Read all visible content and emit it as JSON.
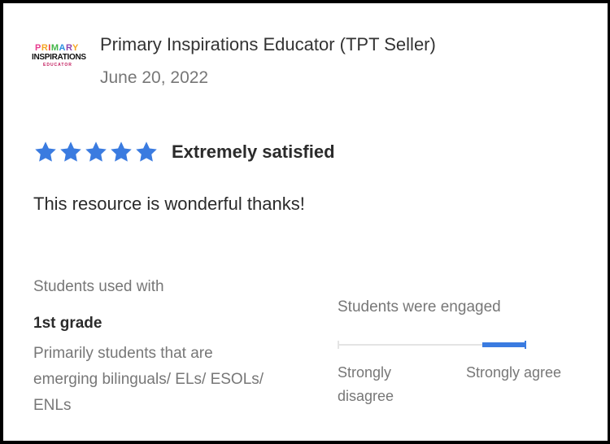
{
  "review": {
    "logo": {
      "line1": [
        "P",
        "R",
        "I",
        "M",
        "A",
        "R",
        "Y"
      ],
      "line2": "INSPIRATIONS",
      "line3": "EDUCATOR"
    },
    "author": "Primary Inspirations Educator (TPT Seller)",
    "date": "June 20, 2022",
    "rating": {
      "stars": 5,
      "max": 5,
      "label": "Extremely satisfied"
    },
    "text": "This resource is wonderful thanks!",
    "students_used_with": {
      "heading": "Students used with",
      "grade": "1st grade",
      "description": "Primarily students that are emerging bilinguals/ ELs/ ESOLs/ ENLs"
    },
    "engagement": {
      "heading": "Students were engaged",
      "value_fraction": 0.8,
      "left_label": "Strongly disagree",
      "right_label": "Strongly agree"
    }
  },
  "colors": {
    "star": "#3a7be0",
    "scale_fill": "#3a7be0",
    "scale_track": "#e4e4e4",
    "border": "#000000"
  },
  "icons": {
    "rating": "star-icon"
  }
}
